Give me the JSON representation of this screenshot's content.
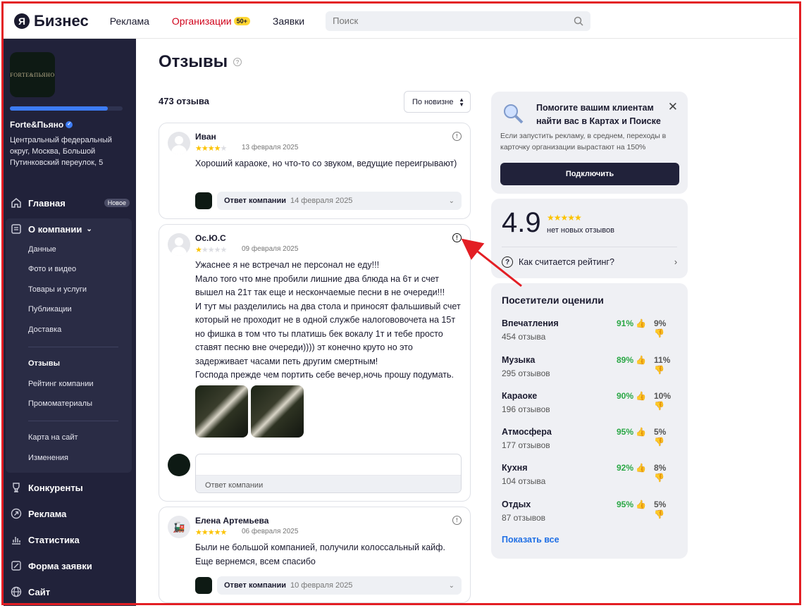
{
  "header": {
    "logo_mark": "Я",
    "logo_text": "Бизнес",
    "nav": [
      {
        "label": "Реклама"
      },
      {
        "label": "Организации",
        "badge": "50+"
      },
      {
        "label": "Заявки"
      }
    ],
    "search_placeholder": "Поиск"
  },
  "sidebar": {
    "avatar_text": "FORTE&ПЬЯНО",
    "progress_fraction": 0.87,
    "org_name": "Forte&Пьяно",
    "org_address": "Центральный федеральный округ, Москва, Большой Путинковский переулок, 5",
    "main_label": "Главная",
    "main_badge": "Новое",
    "about_label": "О компании",
    "sub_items": [
      "Данные",
      "Фото и видео",
      "Товары и услуги",
      "Публикации",
      "Доставка",
      "Отзывы",
      "Рейтинг компании",
      "Промоматериалы",
      "Карта на сайт",
      "Изменения"
    ],
    "bottom_items": [
      "Конкуренты",
      "Реклама",
      "Статистика",
      "Форма заявки",
      "Сайт"
    ]
  },
  "page": {
    "title": "Отзывы",
    "count": "473 отзыва",
    "sort_label": "По новизне"
  },
  "reviews": [
    {
      "name": "Иван",
      "rating": 4,
      "date": "13 февраля 2025",
      "text": "Хороший караоке, но что-то со звуком, ведущие переигрывают)",
      "reply_label": "Ответ компании",
      "reply_date": "14 февраля 2025"
    },
    {
      "name": "Ос.Ю.С",
      "rating": 1,
      "date": "09 февраля 2025",
      "text": "Ужаснее я не встречал не персонал не еду!!!\nМало того что мне пробили лишние два блюда на 6т и счет вышел на 21т так еще и нескончаемые песни в не очереди!!!\nИ тут мы разделились на два стола и приносят фальшивый счет который не проходит не в одной службе налогововочета на 15т но фишка в том что ты платишь бек вокалу 1т и тебе просто ставят песню вне очереди)))) эт конечно круто но это задерживает часами петь другим смертным!\nГоспода прежде чем портить себе вечер,ночь прошу подумать.",
      "answer_placeholder": "Ответ компании"
    },
    {
      "name": "Елена Артемьева",
      "rating": 5,
      "date": "06 февраля 2025",
      "text": "Были не большой компанией, получили колоссальный кайф.\nЕще вернемся, всем спасибо",
      "reply_label": "Ответ компании",
      "reply_date": "10 февраля 2025"
    }
  ],
  "promo": {
    "title": "Помогите вашим клиентам найти вас в Картах и Поиске",
    "text": "Если запустить рекламу, в среднем, переходы в карточку организации вырастают на 150%",
    "button": "Подключить"
  },
  "rating": {
    "value": "4.9",
    "stars": "★★★★★",
    "subtitle": "нет новых отзывов",
    "link": "Как считается рейтинг?"
  },
  "visitors": {
    "title": "Посетители оценили",
    "rows": [
      {
        "name": "Впечатления",
        "count": "454 отзыва",
        "positive": "91%",
        "negative": "9%"
      },
      {
        "name": "Музыка",
        "count": "295 отзывов",
        "positive": "89%",
        "negative": "11%"
      },
      {
        "name": "Караоке",
        "count": "196 отзывов",
        "positive": "90%",
        "negative": "10%"
      },
      {
        "name": "Атмосфера",
        "count": "177 отзывов",
        "positive": "95%",
        "negative": "5%"
      },
      {
        "name": "Кухня",
        "count": "104 отзыва",
        "positive": "92%",
        "negative": "8%"
      },
      {
        "name": "Отдых",
        "count": "87 отзывов",
        "positive": "95%",
        "negative": "5%"
      }
    ],
    "show_all": "Показать все"
  },
  "colors": {
    "accent_red": "#d0021b",
    "annotation_red": "#e31e24",
    "sidebar": "#21223a",
    "positive": "#2aa745",
    "link": "#1f6fe5"
  }
}
